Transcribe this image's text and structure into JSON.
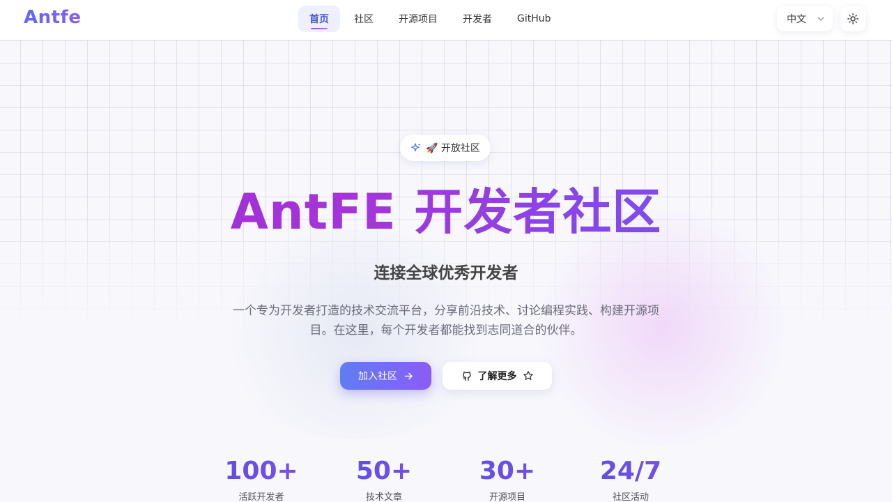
{
  "brand": {
    "logo": "Antfe"
  },
  "nav": {
    "items": [
      {
        "label": "首页",
        "active": true
      },
      {
        "label": "社区"
      },
      {
        "label": "开源项目"
      },
      {
        "label": "开发者"
      },
      {
        "label": "GitHub"
      }
    ]
  },
  "header": {
    "language": "中文",
    "theme_icon": "sun-icon"
  },
  "hero": {
    "badge": "🚀 开放社区",
    "title": "AntFE 开发者社区",
    "subtitle": "连接全球优秀开发者",
    "description_line1": "一个专为开发者打造的技术交流平台，分享前沿技术、讨论编程实践、构建开源项",
    "description_line2": "目。在这里，每个开发者都能找到志同道合的伙伴。",
    "primary_button": "加入社区",
    "secondary_button": "了解更多"
  },
  "stats": [
    {
      "value": "100+",
      "label": "活跃开发者"
    },
    {
      "value": "50+",
      "label": "技术文章"
    },
    {
      "value": "30+",
      "label": "开源项目"
    },
    {
      "value": "24/7",
      "label": "社区活动"
    }
  ],
  "colors": {
    "accent": "#6e5cf4",
    "title_gradient_start": "#9b2ad6",
    "primary_button_start": "#5f7df4",
    "primary_button_end": "#8b5cf6"
  }
}
